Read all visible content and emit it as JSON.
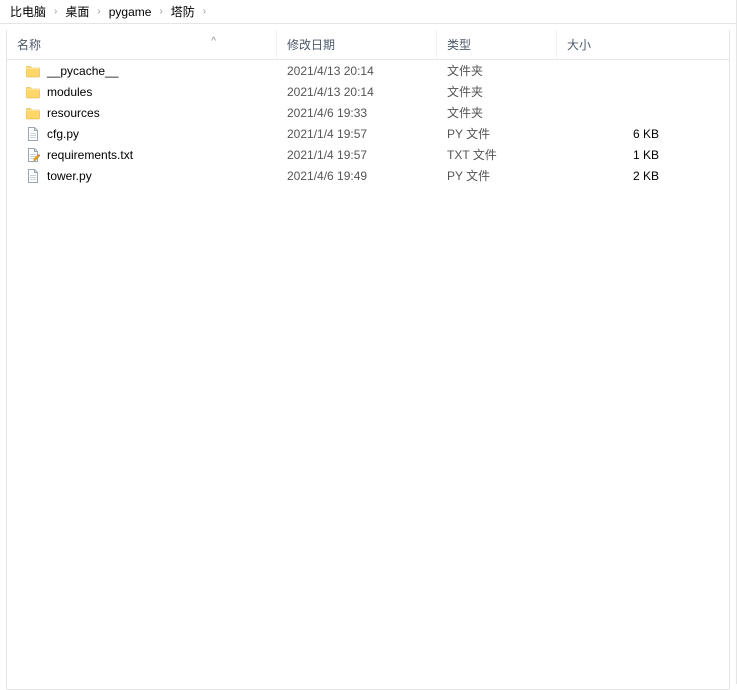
{
  "breadcrumb": {
    "items": [
      "比电脑",
      "桌面",
      "pygame",
      "塔防"
    ]
  },
  "headers": {
    "name": "名称",
    "modified": "修改日期",
    "type": "类型",
    "size": "大小"
  },
  "files": [
    {
      "name": "__pycache__",
      "modified": "2021/4/13 20:14",
      "type": "文件夹",
      "size": "",
      "icon": "folder"
    },
    {
      "name": "modules",
      "modified": "2021/4/13 20:14",
      "type": "文件夹",
      "size": "",
      "icon": "folder"
    },
    {
      "name": "resources",
      "modified": "2021/4/6 19:33",
      "type": "文件夹",
      "size": "",
      "icon": "folder"
    },
    {
      "name": "cfg.py",
      "modified": "2021/1/4 19:57",
      "type": "PY 文件",
      "size": "6 KB",
      "icon": "file"
    },
    {
      "name": "requirements.txt",
      "modified": "2021/1/4 19:57",
      "type": "TXT 文件",
      "size": "1 KB",
      "icon": "txtedit"
    },
    {
      "name": "tower.py",
      "modified": "2021/4/6 19:49",
      "type": "PY 文件",
      "size": "2 KB",
      "icon": "file"
    }
  ]
}
